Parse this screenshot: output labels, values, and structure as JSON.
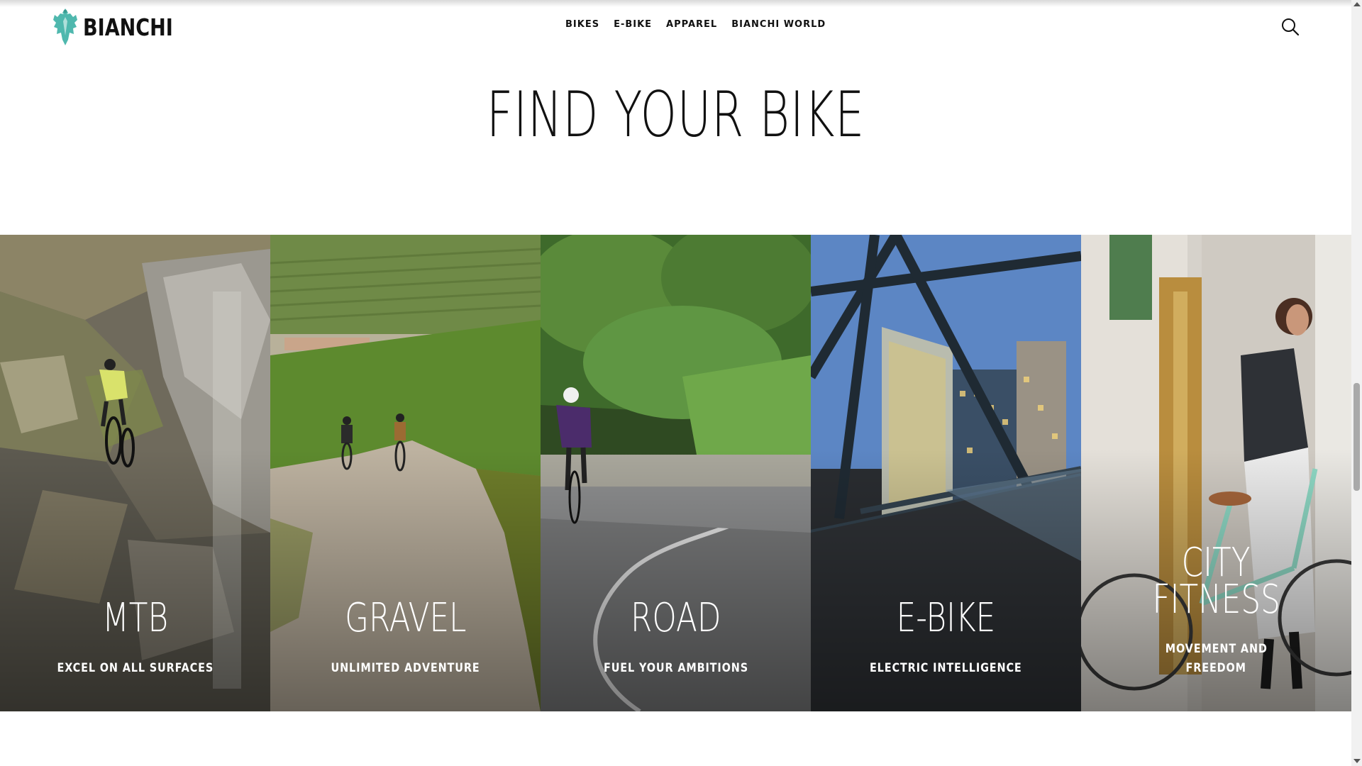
{
  "brand": {
    "name": "BIANCHI",
    "logo_icon": "eagle-crest-icon",
    "logo_color": "#4fb8ae"
  },
  "nav": {
    "items": [
      {
        "label": "BIKES"
      },
      {
        "label": "E-BIKE"
      },
      {
        "label": "APPAREL"
      },
      {
        "label": "BIANCHI WORLD"
      }
    ],
    "search_icon": "search-icon"
  },
  "main": {
    "headline": "FIND YOUR BIKE",
    "categories": [
      {
        "title": "MTB",
        "subtitle": "EXCEL ON ALL SURFACES"
      },
      {
        "title": "GRAVEL",
        "subtitle": "UNLIMITED ADVENTURE"
      },
      {
        "title": "ROAD",
        "subtitle": "FUEL YOUR AMBITIONS"
      },
      {
        "title": "E-BIKE",
        "subtitle": "ELECTRIC INTELLIGENCE"
      },
      {
        "title_line1": "CITY",
        "title_line2": "FITNESS",
        "subtitle_line1": "MOVEMENT AND",
        "subtitle_line2": "FREEDOM"
      }
    ]
  },
  "colors": {
    "accent": "#4fb8ae",
    "text": "#111111",
    "celeste_bike": "#8ed8c4"
  }
}
